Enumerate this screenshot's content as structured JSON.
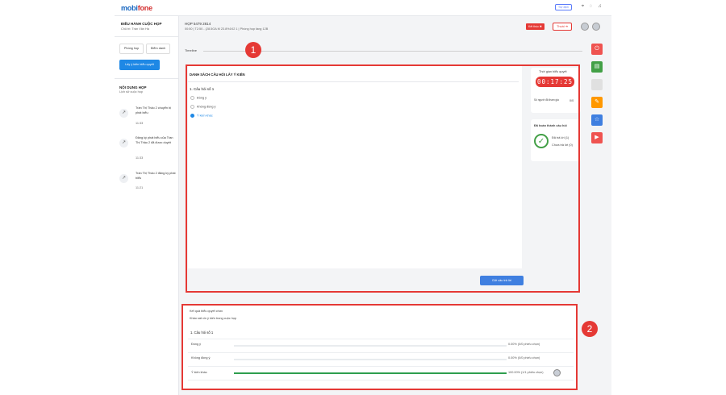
{
  "header": {
    "logo_main": "mobi",
    "logo_accent": "fone",
    "help_label": "Trợ định"
  },
  "sidebar": {
    "title": "ĐIỀU HÀNH CUỘC HỌP",
    "chair": "Chủ trì: Trần Văn Hà",
    "tab_room": "Phòng họp",
    "tab_attendance": "Điểm danh",
    "vote_button": "Lấy ý kiến biểu quyết",
    "content_title": "NỘI DUNG HỌP",
    "content_sub": "Lịch sử cuộc họp",
    "activities": [
      {
        "text": "Trần Thị Thảo 2 chuyển bị phát biểu",
        "time": "11:33"
      },
      {
        "text": "Đăng ký phát biểu của Trần Thị Thảo 2 đã được duyệt",
        "time": "11:33"
      },
      {
        "text": "Trần Thị Thảo 2 đăng ký phát biểu",
        "time": "11:21"
      }
    ]
  },
  "meeting": {
    "id": "HỌP 5479 2814",
    "info": "00:50 | T2:50 - (28.5GA M 23.8%1K2 1 | Phòng họp tầng 12B",
    "end_label": "Kết thúc ✖",
    "out_label": "Thoát ➜",
    "timeline_label": "Timeline"
  },
  "markers": {
    "one": "1",
    "two": "2"
  },
  "poll": {
    "title": "DANH SÁCH CÂU HỎI LẤY Ý KIẾN",
    "question": "1. Câu hỏi số 1",
    "options": [
      "Đồng ý",
      "Không đồng ý",
      "Ý kiến khác"
    ],
    "selected_index": 2,
    "send_button": "Gửi câu trả lời"
  },
  "side_panel": {
    "time_label": "Thời gian biểu quyết",
    "timer": "00:17:25",
    "count_label": "Số người đã tham gia",
    "count_value": "0/0",
    "status_title": "Đã hoàn thành câu hỏi",
    "done_line": "Đã trả lời (1)",
    "pending_line": "Chưa trả lời (0)"
  },
  "action_icons": [
    {
      "name": "power-icon",
      "glyph": "⏻",
      "color": "#ef5350"
    },
    {
      "name": "document-icon",
      "glyph": "▤",
      "color": "#43a047"
    },
    {
      "name": "blank-icon",
      "glyph": "",
      "color": "#e0e0e0"
    },
    {
      "name": "edit-icon",
      "glyph": "✎",
      "color": "#ff9800"
    },
    {
      "name": "star-icon",
      "glyph": "☆",
      "color": "#3f7fe0"
    },
    {
      "name": "video-icon",
      "glyph": "▶",
      "color": "#ef5350"
    }
  ],
  "results": {
    "title": "Kết quả biểu quyết chức",
    "subtitle": "Khảo sát xin ý kiến trong cuộc họp",
    "question": "1. Câu hỏi số 1",
    "rows": [
      {
        "label": "Đồng ý",
        "value_text": "0.00% (0/0 phiếu chọn)",
        "percent": 0
      },
      {
        "label": "Không đồng ý",
        "value_text": "0.00% (0/0 phiếu chọn)",
        "percent": 0
      },
      {
        "label": "Ý kiến khác",
        "value_text": "100.00% (1/1 phiếu chọn)",
        "percent": 100
      }
    ]
  },
  "colors": {
    "brand": "#1565c0",
    "accent": "#e53935",
    "progress": "#2e9e4e",
    "primary_button": "#1e88e5"
  }
}
